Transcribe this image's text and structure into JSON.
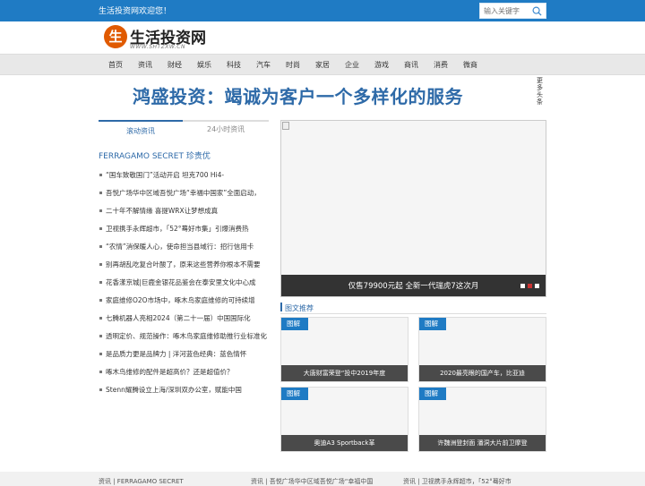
{
  "topbar": {
    "welcome": "生活投资网欢迎您！",
    "search_placeholder": "输入关键字"
  },
  "logo": {
    "mark": "生",
    "name": "生活投资网",
    "url": "WWW.SHTZXW.CN"
  },
  "nav": {
    "items": [
      "首页",
      "资讯",
      "财经",
      "娱乐",
      "科技",
      "汽车",
      "时尚",
      "家居",
      "企业",
      "游戏",
      "商讯",
      "消费",
      "微商"
    ]
  },
  "headline": "鸿盛投资：竭诚为客户一个多样化的服务",
  "more_side": "更多头条",
  "tabs": {
    "active": "滚动资讯",
    "other": "24小时资讯"
  },
  "feature_title": "FERRAGAMO SECRET 珍贵优",
  "news_list": [
    "“国车致敬国门”活动开启 坦克700 Hi4-",
    "吾悦广场华中区域吾悦广场“幸福中国家”全面启动，",
    "二十年不解情缘 喜提WRX让梦想成真",
    "卫视携手永辉超市，「52°蓦好市集」引爆消费热",
    "“农情”消保暖人心，使命担当县域行：招行信用卡",
    "别再胡乱吃复合叶酸了，原来这些营养你根本不需要",
    "花香漾京城|巨鹿金银花品鉴会在泰安里文化中心成",
    "家庭维修O2O市场中，啄木鸟家庭维修的可持续增",
    "七腾机器人亮相2024（第二十一届）中国国际化",
    "透明定价、规范操作：啄木鸟家庭维修助推行业标准化",
    "是品质力更是品牌力 | 洋河蓝色经典：蓝色情怀",
    "啄木鸟维修的配件是超高价？还是超值价？",
    "Stenn耀腾设立上海/深圳双办公室，赋能中国"
  ],
  "slider": {
    "caption": "仅售79900元起 全新一代瑞虎7这次月"
  },
  "pic_recommend": {
    "title": "图文推荐",
    "cards": [
      {
        "badge": "图解",
        "caption": "大唐财富荣登“投中2019年度"
      },
      {
        "badge": "图解",
        "caption": "2020最亮眼的国产车，比亚迪"
      },
      {
        "badge": "图解",
        "caption": "奥迪A3 Sportback革"
      },
      {
        "badge": "图解",
        "caption": "许魏洲登封面 潘洞大片前卫摩登"
      }
    ]
  },
  "bottom": {
    "items": [
      "资讯 | FERRAGAMO SECRET",
      "资讯 | 吾悦广场华中区域吾悦广场“幸福中国",
      "资讯 | 卫视携手永辉超市，「52°蓦好市"
    ]
  },
  "colors": {
    "topbar": "#1f7bc4",
    "accent": "#2e6aa8",
    "logo_mark": "#e05a00"
  }
}
